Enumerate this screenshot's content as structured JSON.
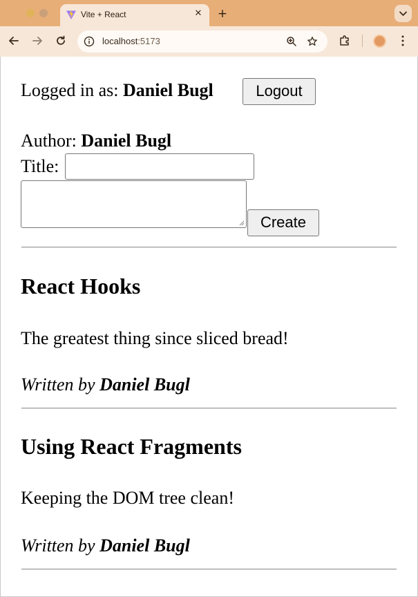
{
  "browser": {
    "tab_title": "Vite + React",
    "url_host": "localhost",
    "url_port": ":5173"
  },
  "header": {
    "logged_in_prefix": "Logged in as: ",
    "username": "Daniel Bugl",
    "logout_label": "Logout"
  },
  "create_form": {
    "author_prefix": "Author: ",
    "author_name": "Daniel Bugl",
    "title_label": "Title:",
    "title_value": "",
    "contents_value": "",
    "create_label": "Create"
  },
  "posts": [
    {
      "title": "React Hooks",
      "contents": "The greatest thing since sliced bread!",
      "written_by_prefix": "Written by ",
      "author": "Daniel Bugl"
    },
    {
      "title": "Using React Fragments",
      "contents": "Keeping the DOM tree clean!",
      "written_by_prefix": "Written by ",
      "author": "Daniel Bugl"
    }
  ],
  "icons": {
    "favicon": "vite-logo-icon",
    "tab_close": "close-icon",
    "new_tab": "plus-icon",
    "tab_search": "chevron-down-icon",
    "back": "arrow-left-icon",
    "forward": "arrow-right-icon",
    "reload": "reload-icon",
    "site_info": "info-icon",
    "zoom": "zoom-icon",
    "bookmark": "star-icon",
    "extensions": "puzzle-icon",
    "profile": "avatar-icon",
    "menu": "more-vertical-icon"
  },
  "colors": {
    "chrome_frame": "#e8ae78",
    "chrome_toolbar": "#f7e7d8",
    "button_bg": "#efefef",
    "button_border": "#767676"
  }
}
